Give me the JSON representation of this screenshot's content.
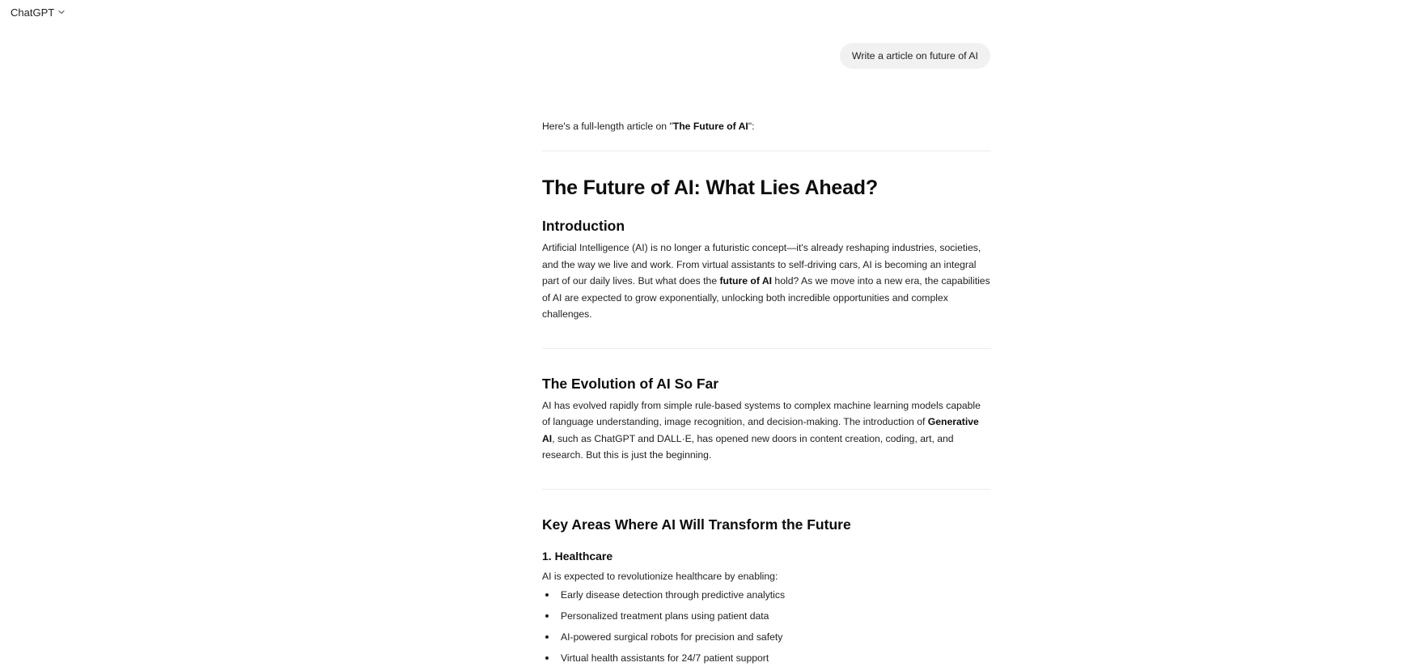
{
  "header": {
    "model_label": "ChatGPT",
    "chevron_icon": "chevron-down-icon"
  },
  "conversation": {
    "user_message": "Write a article on future of AI",
    "assistant": {
      "intro": {
        "prefix": "Here's a full-length article on \"",
        "bold": "The Future of AI",
        "suffix": "\":"
      },
      "title": "The Future of AI: What Lies Ahead?",
      "introduction": {
        "heading": "Introduction",
        "p1": "Artificial Intelligence (AI) is no longer a futuristic concept—it's already reshaping industries, societies, and the way we live and work. From virtual assistants to self-driving cars, AI is becoming an integral part of our daily lives. But what does the ",
        "bold": "future of AI",
        "p2": " hold? As we move into a new era, the capabilities of AI are expected to grow exponentially, unlocking both incredible opportunities and complex challenges."
      },
      "evolution": {
        "heading": "The Evolution of AI So Far",
        "p1": "AI has evolved rapidly from simple rule-based systems to complex machine learning models capable of language understanding, image recognition, and decision-making. The introduction of ",
        "bold": "Generative AI",
        "p2": ", such as ChatGPT and DALL·E, has opened new doors in content creation, coding, art, and research. But this is just the beginning."
      },
      "key_areas": {
        "heading": "Key Areas Where AI Will Transform the Future",
        "healthcare": {
          "number": "1.",
          "heading": "Healthcare",
          "lead": "AI is expected to revolutionize healthcare by enabling:",
          "bullets": [
            "Early disease detection through predictive analytics",
            "Personalized treatment plans using patient data",
            "AI-powered surgical robots for precision and safety",
            "Virtual health assistants for 24/7 patient support"
          ]
        }
      }
    }
  }
}
